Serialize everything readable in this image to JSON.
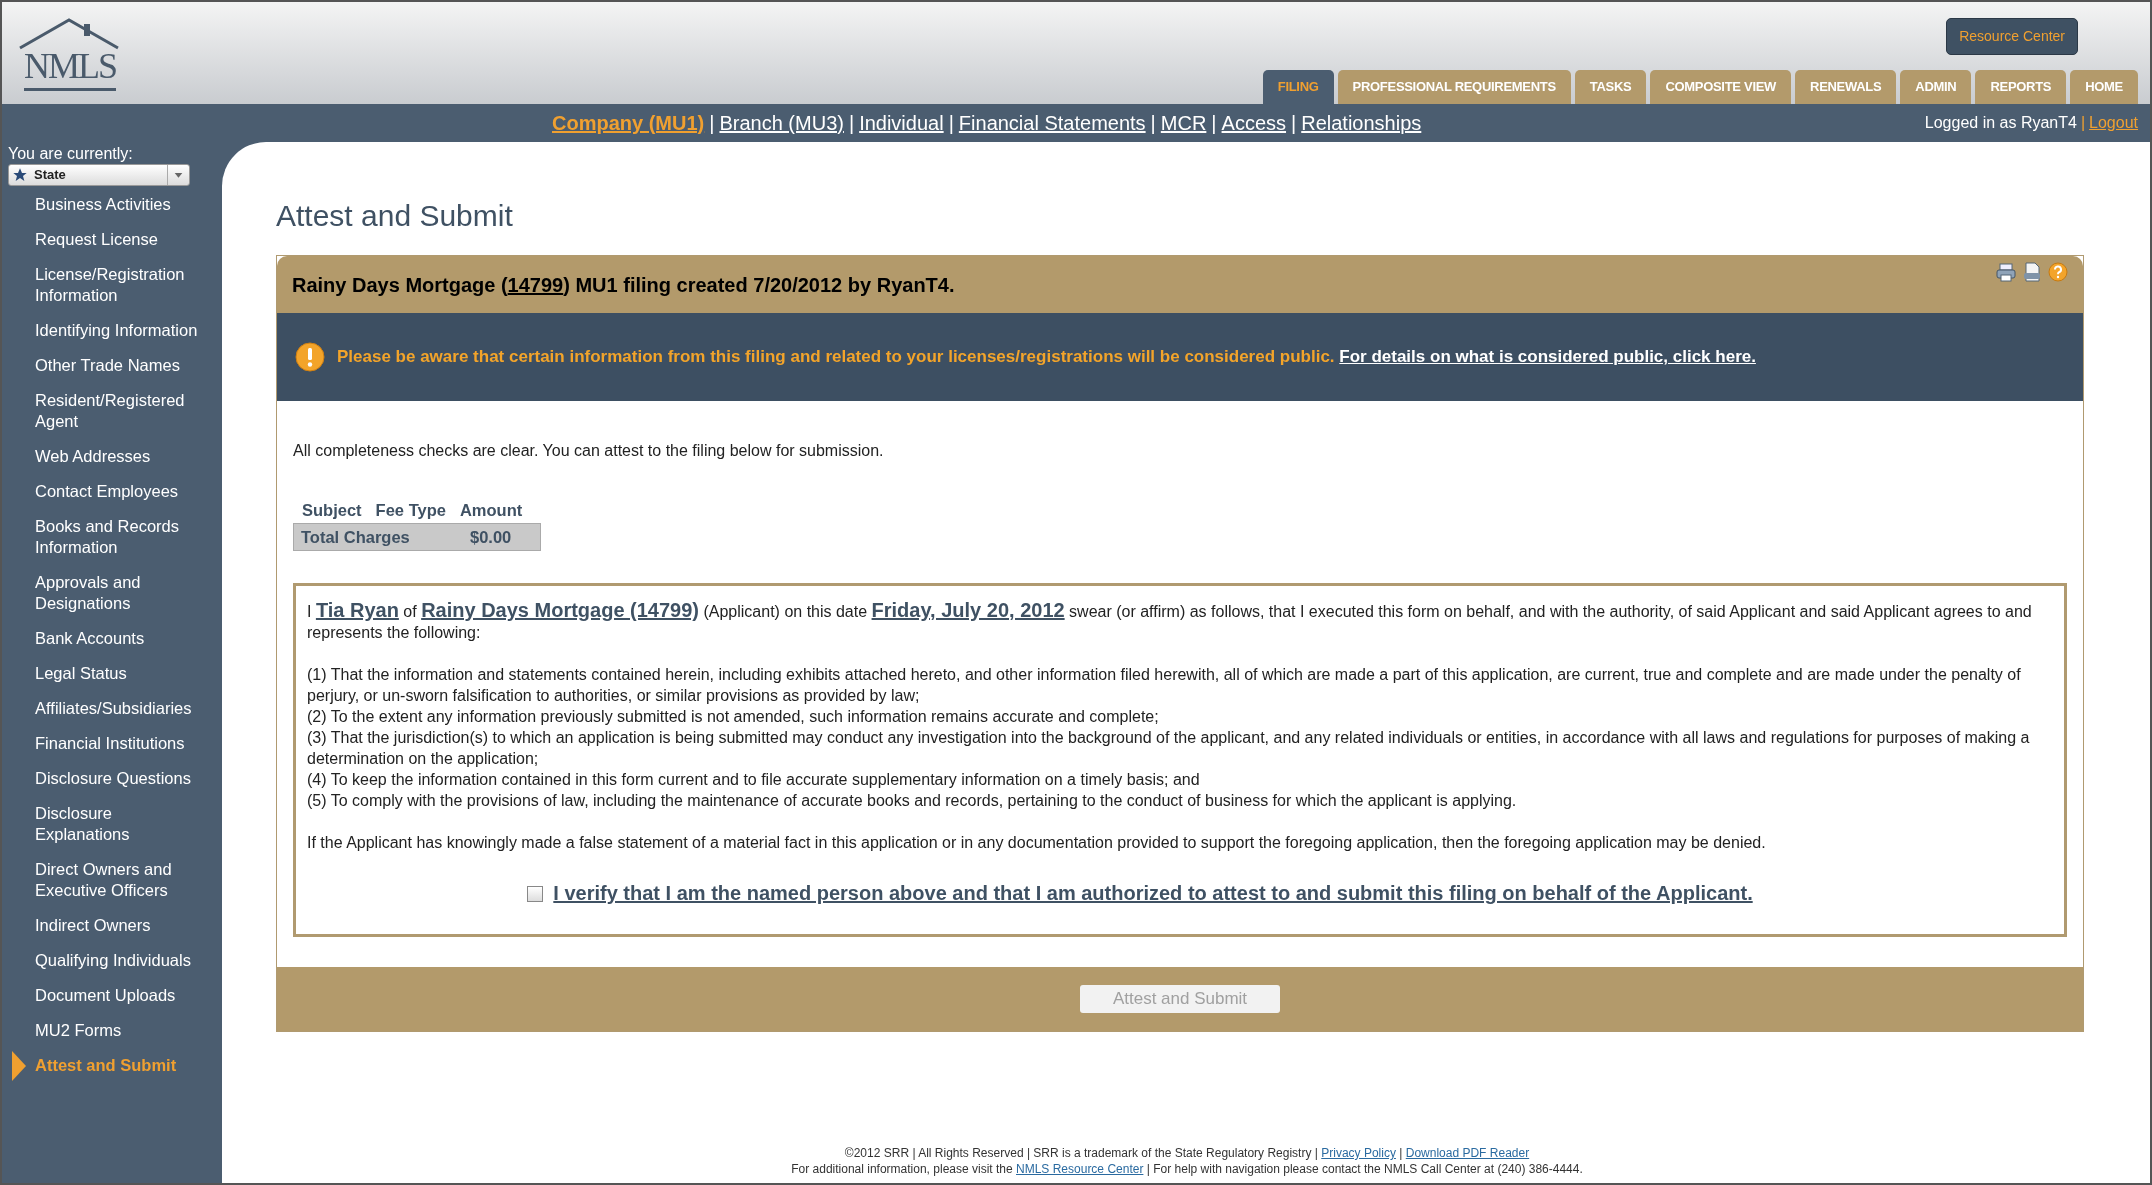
{
  "header": {
    "logo": "NMLS",
    "resource_button": "Resource Center",
    "tabs": [
      {
        "label": "FILING",
        "selected": true
      },
      {
        "label": "PROFESSIONAL REQUIREMENTS",
        "selected": false
      },
      {
        "label": "TASKS",
        "selected": false
      },
      {
        "label": "COMPOSITE VIEW",
        "selected": false
      },
      {
        "label": "RENEWALS",
        "selected": false
      },
      {
        "label": "ADMIN",
        "selected": false
      },
      {
        "label": "REPORTS",
        "selected": false
      },
      {
        "label": "HOME",
        "selected": false
      }
    ],
    "subnav": [
      {
        "label": "Company (MU1)",
        "selected": true
      },
      {
        "label": "Branch (MU3)",
        "selected": false
      },
      {
        "label": "Individual",
        "selected": false
      },
      {
        "label": "Financial Statements",
        "selected": false
      },
      {
        "label": "MCR",
        "selected": false
      },
      {
        "label": "Access",
        "selected": false
      },
      {
        "label": "Relationships",
        "selected": false
      }
    ],
    "separator": "|",
    "user": "Logged in as RyanT4",
    "user_separator": "|",
    "logout": "Logout"
  },
  "sidebar": {
    "caption": "You are currently:",
    "selector": "State",
    "items": [
      {
        "label": "Business Activities",
        "selected": false
      },
      {
        "label": "Request License",
        "selected": false
      },
      {
        "label": "License/Registration Information",
        "selected": false
      },
      {
        "label": "Identifying Information",
        "selected": false
      },
      {
        "label": "Other Trade Names",
        "selected": false
      },
      {
        "label": "Resident/Registered Agent",
        "selected": false
      },
      {
        "label": "Web Addresses",
        "selected": false
      },
      {
        "label": "Contact Employees",
        "selected": false
      },
      {
        "label": "Books and Records Information",
        "selected": false
      },
      {
        "label": "Approvals and Designations",
        "selected": false
      },
      {
        "label": "Bank Accounts",
        "selected": false
      },
      {
        "label": "Legal Status",
        "selected": false
      },
      {
        "label": "Affiliates/Subsidiaries",
        "selected": false
      },
      {
        "label": "Financial Institutions",
        "selected": false
      },
      {
        "label": "Disclosure Questions",
        "selected": false
      },
      {
        "label": "Disclosure Explanations",
        "selected": false
      },
      {
        "label": "Direct Owners and Executive Officers",
        "selected": false
      },
      {
        "label": "Indirect Owners",
        "selected": false
      },
      {
        "label": "Qualifying Individuals",
        "selected": false
      },
      {
        "label": "Document Uploads",
        "selected": false
      },
      {
        "label": "MU2 Forms",
        "selected": false
      },
      {
        "label": "Attest and Submit",
        "selected": true
      }
    ]
  },
  "page_title": "Attest and Submit",
  "filing": {
    "title_before": "Rainy Days Mortgage (",
    "title_link": "14799",
    "title_after": ") MU1 filing created 7/20/2012 by RyanT4.",
    "notice": {
      "text": "Please be aware that certain information from this filing and related to your licenses/registrations will be considered public.",
      "link": "For details on what is considered public, click here."
    },
    "status": "All completeness checks are clear. You can attest to the filing below for submission.",
    "fees": {
      "columns": [
        "Subject",
        "Fee Type",
        "Amount"
      ],
      "total_label": "Total Charges",
      "total_amount": "$0.00"
    },
    "attestation": {
      "intro": [
        {
          "kind": "text",
          "text": "I "
        },
        {
          "kind": "value",
          "text": "Tia Ryan"
        },
        {
          "kind": "text",
          "text": " of "
        },
        {
          "kind": "value",
          "text": "Rainy Days Mortgage (14799)"
        },
        {
          "kind": "text",
          "text": " (Applicant) on this date "
        },
        {
          "kind": "value",
          "text": "Friday, July 20, 2012"
        },
        {
          "kind": "text",
          "text": " swear (or affirm) as follows, that I executed this form on behalf, and with the authority, of said Applicant and said Applicant agrees to and represents the following:"
        }
      ],
      "items": [
        "(1) That the information and statements contained herein, including exhibits attached hereto, and other information filed herewith, all of which are made a part of this application, are current, true and complete and are made under the penalty of perjury, or un-sworn falsification to authorities, or similar provisions as provided by law;",
        "(2) To the extent any information previously submitted is not amended, such information remains accurate and complete;",
        "(3) That the jurisdiction(s) to which an application is being submitted may conduct any investigation into the background of the applicant, and any related individuals or entities, in accordance with all laws and regulations for purposes of making a determination on the application;",
        "(4) To keep the information contained in this form current and to file accurate supplementary information on a timely basis; and",
        "(5) To comply with the provisions of law, including the maintenance of accurate books and records, pertaining to the conduct of business for which the applicant is applying."
      ],
      "warning": "If the Applicant has knowingly made a false statement of a material fact in this application or in any documentation provided to support the foregoing application, then the foregoing application may be denied."
    },
    "verify": {
      "checked": false,
      "label": "I verify that I am the named person above and that I am authorized to attest to and submit this filing on behalf of the Applicant."
    },
    "submit": {
      "label": "Attest and Submit",
      "disabled": true
    }
  },
  "footer": {
    "lines": [
      [
        {
          "kind": "text",
          "text": "©2012 SRR | All Rights Reserved | SRR is a trademark of the State Regulatory Registry |"
        },
        {
          "kind": "link",
          "text": "Privacy Policy"
        },
        {
          "kind": "text",
          "text": "|"
        },
        {
          "kind": "link",
          "text": "Download PDF Reader"
        }
      ],
      [
        {
          "kind": "text",
          "text": "For additional information, please visit the"
        },
        {
          "kind": "link",
          "text": "NMLS Resource Center"
        },
        {
          "kind": "text",
          "text": "| For help with navigation please contact the NMLS Call Center at (240) 386-4444."
        }
      ]
    ]
  }
}
